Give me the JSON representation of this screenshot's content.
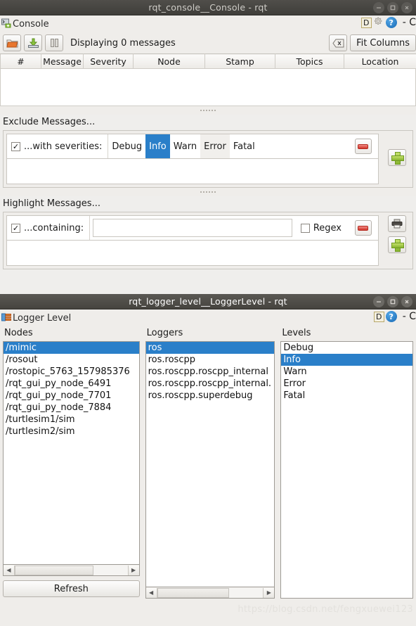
{
  "console_window": {
    "title": "rqt_console__Console - rqt",
    "window_buttons": [
      "minimize",
      "maximize",
      "close"
    ],
    "plugin": {
      "icon": "console-plugin-icon",
      "title": "Console",
      "dock_label": "D",
      "gear_icon": "gear-icon",
      "help_icon": "help-icon",
      "close_text": "- C"
    },
    "toolbar": {
      "open_icon": "open-folder-icon",
      "save_icon": "save-icon",
      "pause_icon": "pause-icon",
      "status": "Displaying 0 messages",
      "clear_icon": "clear-messages-icon",
      "fit_columns_label": "Fit Columns"
    },
    "table": {
      "columns": [
        "#",
        "Message",
        "Severity",
        "Node",
        "Stamp",
        "Topics",
        "Location"
      ],
      "rows": []
    },
    "exclude": {
      "label": "Exclude Messages...",
      "checkbox_checked": true,
      "check_glyph": "✓",
      "row_label": "...with severities:",
      "severities": [
        {
          "label": "Debug",
          "state": "normal"
        },
        {
          "label": "Info",
          "state": "selected"
        },
        {
          "label": "Warn",
          "state": "normal"
        },
        {
          "label": "Error",
          "state": "hover"
        },
        {
          "label": "Fatal",
          "state": "normal"
        }
      ],
      "remove_icon": "remove-filter-icon",
      "add_icon": "add-filter-icon"
    },
    "highlight": {
      "label": "Highlight Messages...",
      "checkbox_checked": true,
      "check_glyph": "✓",
      "row_label": "...containing:",
      "input_value": "",
      "input_placeholder": "",
      "regex_label": "Regex",
      "regex_checked": false,
      "remove_icon": "remove-filter-icon",
      "print_icon": "print-icon",
      "add_icon": "add-filter-icon"
    }
  },
  "logger_window": {
    "title": "rqt_logger_level__LoggerLevel - rqt",
    "plugin": {
      "icon": "logger-plugin-icon",
      "title": "Logger Level",
      "dock_label": "D",
      "help_icon": "help-icon",
      "close_text": "- C"
    },
    "nodes": {
      "header": "Nodes",
      "items": [
        "/mimic",
        "/rosout",
        "/rostopic_5763_157985376",
        "/rqt_gui_py_node_6491",
        "/rqt_gui_py_node_7701",
        "/rqt_gui_py_node_7884",
        "/turtlesim1/sim",
        "/turtlesim2/sim"
      ],
      "selected_index": 0
    },
    "loggers": {
      "header": "Loggers",
      "items": [
        "ros",
        "ros.roscpp",
        "ros.roscpp.roscpp_internal",
        "ros.roscpp.roscpp_internal.",
        "ros.roscpp.superdebug"
      ],
      "selected_index": 0
    },
    "levels": {
      "header": "Levels",
      "items": [
        "Debug",
        "Info",
        "Warn",
        "Error",
        "Fatal"
      ],
      "selected_index": 1
    },
    "refresh_label": "Refresh"
  },
  "watermark": "https://blog.csdn.net/fengxuewei123",
  "colors": {
    "selection_blue": "#2a7fc9",
    "window_bg": "#efedea",
    "titlebar_inactive": "#45443f",
    "titlebar_active": "#504e49",
    "close_active": "#e2683b"
  }
}
